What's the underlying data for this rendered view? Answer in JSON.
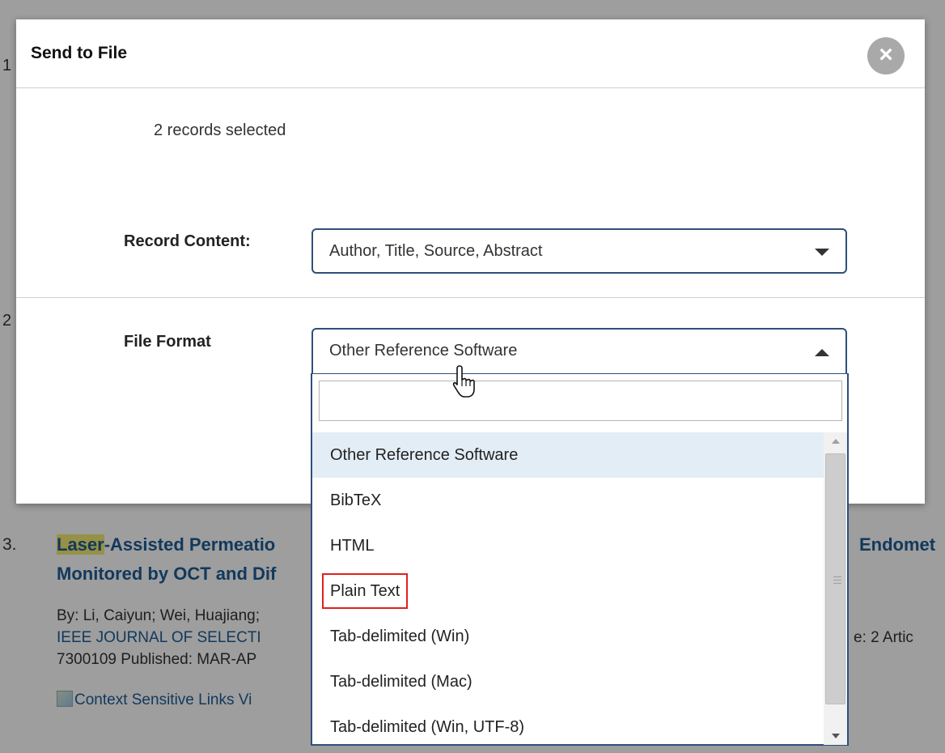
{
  "background": {
    "result_3": {
      "number": "3.",
      "title_highlight": "Laser",
      "title_rest_line1": "-Assisted Permeatio",
      "title_line2": "Monitored by OCT and Dif",
      "title_right": "Endomet",
      "authors": "By: Li, Caiyun; Wei, Huajiang;",
      "journal": "IEEE JOURNAL OF SELECTI",
      "issue_right": "e: 2   Artic",
      "published": "7300109   Published: MAR-AP",
      "links": "Context Sensitive Links  Vi"
    },
    "left_marker_1": "1",
    "left_marker_2": "2"
  },
  "modal": {
    "title": "Send to File",
    "close_label": "×",
    "records_selected": "2 records selected",
    "record_content": {
      "label": "Record Content:",
      "value": "Author, Title, Source, Abstract"
    },
    "file_format": {
      "label": "File Format",
      "value": "Other Reference Software",
      "search_placeholder": "",
      "options": [
        "Other Reference Software",
        "BibTeX",
        "HTML",
        "Plain Text",
        "Tab-delimited (Win)",
        "Tab-delimited (Mac)",
        "Tab-delimited (Win, UTF-8)"
      ],
      "selected_index": 0,
      "highlighted_index": 3
    }
  },
  "colors": {
    "link_blue": "#1d5c95",
    "select_border": "#2f4f79",
    "selected_option_bg": "#e3edf6",
    "annotation_red": "#e0201c",
    "search_highlight": "#f2ea73"
  },
  "icons": {
    "close": "close-circle-icon",
    "dropdown_closed": "caret-down-icon",
    "dropdown_open": "caret-up-icon",
    "cursor": "hand-pointer-icon",
    "broken_image": "broken-image-icon"
  }
}
